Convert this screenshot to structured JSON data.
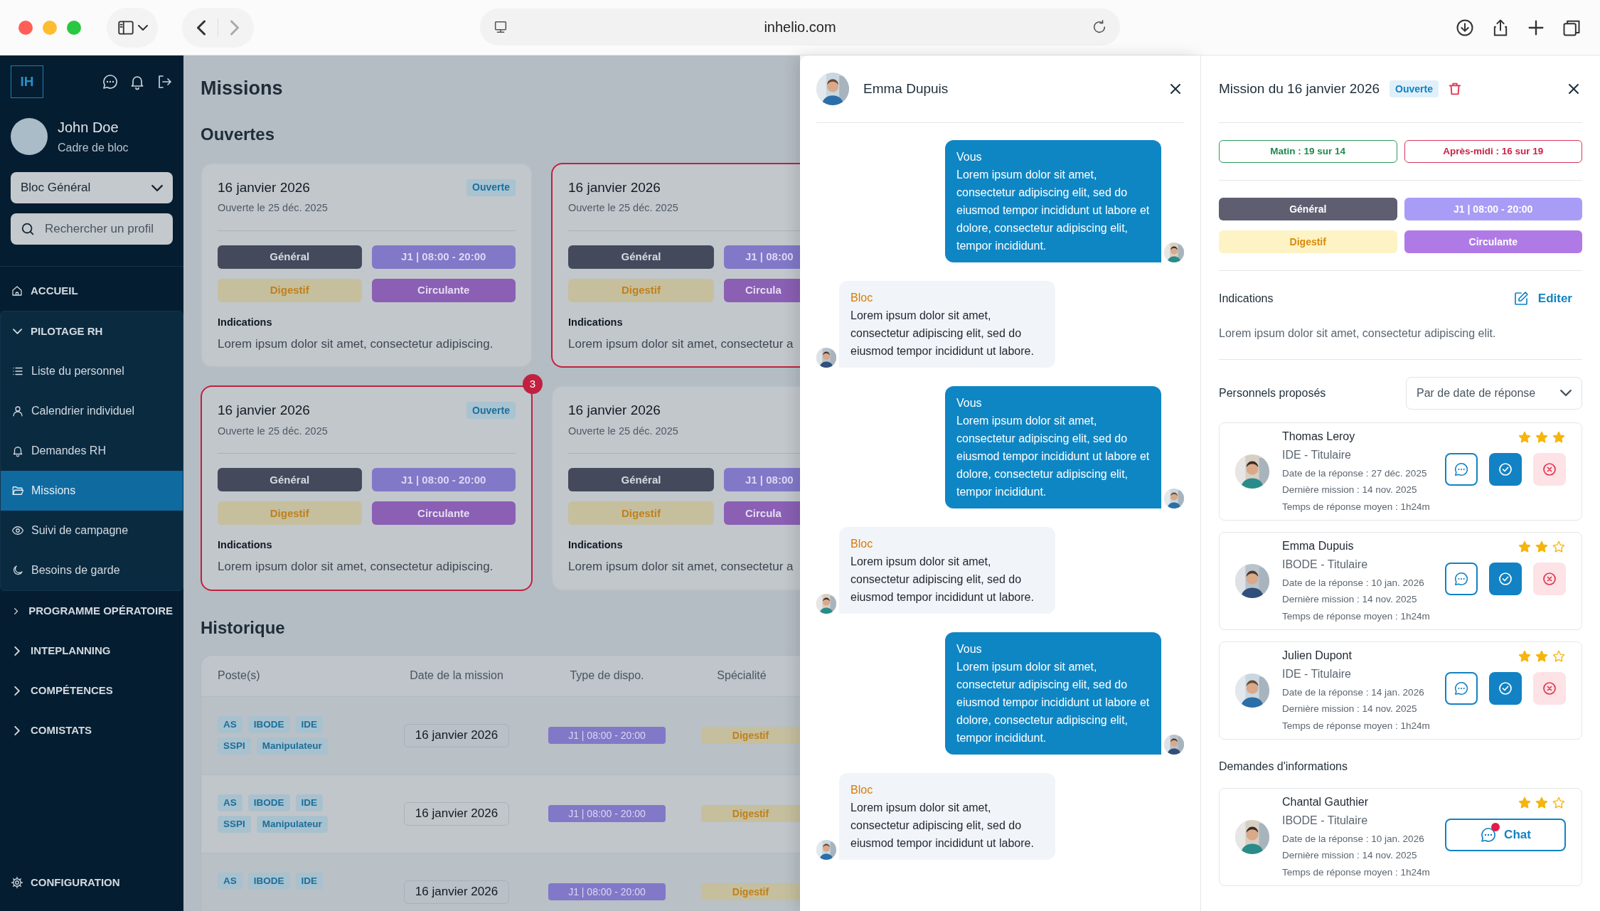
{
  "browser": {
    "url": "inhelio.com"
  },
  "sidebar": {
    "logo": "IH",
    "user": {
      "name": "John Doe",
      "role": "Cadre de bloc"
    },
    "site_select": "Bloc Général",
    "search": {
      "placeholder": "Rechercher un profil"
    },
    "nav": [
      {
        "label": "ACCUEIL",
        "kind": "link"
      },
      {
        "label": "PILOTAGE RH",
        "kind": "section",
        "expanded": true,
        "children": [
          {
            "label": "Liste du personnel",
            "selected": false
          },
          {
            "label": "Calendrier individuel",
            "selected": false
          },
          {
            "label": "Demandes RH",
            "selected": false
          },
          {
            "label": "Missions",
            "selected": true
          },
          {
            "label": "Suivi de campagne",
            "selected": false
          },
          {
            "label": "Besoins de garde",
            "selected": false
          }
        ]
      },
      {
        "label": "PROGRAMME OPÉRATOIRE",
        "kind": "section",
        "expanded": false
      },
      {
        "label": "INTEPLANNING",
        "kind": "section",
        "expanded": false
      },
      {
        "label": "COMPÉTENCES",
        "kind": "section",
        "expanded": false
      },
      {
        "label": "COMISTATS",
        "kind": "section",
        "expanded": false
      }
    ],
    "footer_link": "CONFIGURATION"
  },
  "main": {
    "title": "Missions",
    "open_missions": {
      "title": "Ouvertes",
      "cards": [
        {
          "date": "16 janvier 2026",
          "opened": "Ouverte le 25 déc. 2025",
          "status": "Ouverte",
          "alert": false,
          "clipped": false,
          "tags": [
            {
              "label": "Général",
              "kind": "service"
            },
            {
              "label": "J1 | 08:00 - 20:00",
              "kind": "shift"
            },
            {
              "label": "Digestif",
              "kind": "specialty"
            },
            {
              "label": "Circulante",
              "kind": "role"
            }
          ],
          "indications_label": "Indications",
          "indications": "Lorem ipsum dolor sit amet, consectetur adipiscing."
        },
        {
          "date": "16 janvier 2026",
          "opened": "Ouverte le 25 déc. 2025",
          "alert": true,
          "clipped": true,
          "tags": [
            {
              "label": "Général",
              "kind": "service"
            },
            {
              "label": "J1 | 08:00",
              "kind": "shift"
            },
            {
              "label": "Digestif",
              "kind": "specialty"
            },
            {
              "label": "Circula",
              "kind": "role"
            }
          ],
          "indications_label": "Indications",
          "indications": "Lorem ipsum dolor sit amet, consectetur a"
        },
        {
          "date": "16 janvier 2026",
          "opened": "Ouverte le 25 déc. 2025",
          "status": "Ouverte",
          "alert": true,
          "count": "3",
          "clipped": false,
          "tags": [
            {
              "label": "Général",
              "kind": "service"
            },
            {
              "label": "J1 | 08:00 - 20:00",
              "kind": "shift"
            },
            {
              "label": "Digestif",
              "kind": "specialty"
            },
            {
              "label": "Circulante",
              "kind": "role"
            }
          ],
          "indications_label": "Indications",
          "indications": "Lorem ipsum dolor sit amet, consectetur adipiscing."
        },
        {
          "date": "16 janvier 2026",
          "opened": "Ouverte le 25 déc. 2025",
          "alert": false,
          "clipped": true,
          "tags": [
            {
              "label": "Général",
              "kind": "service"
            },
            {
              "label": "J1 | 08:00",
              "kind": "shift"
            },
            {
              "label": "Digestif",
              "kind": "specialty"
            },
            {
              "label": "Circula",
              "kind": "role"
            }
          ],
          "indications_label": "Indications",
          "indications": "Lorem ipsum dolor sit amet, consectetur a"
        }
      ]
    },
    "history": {
      "title": "Historique",
      "columns": [
        "Poste(s)",
        "Date de la mission",
        "Type de dispo.",
        "Spécialité"
      ],
      "rows": [
        {
          "postes": [
            "AS",
            "IBODE",
            "IDE",
            "SSPI",
            "Manipulateur"
          ],
          "date": "16 janvier 2026",
          "dispo": "J1 | 08:00 - 20:00",
          "specialite": "Digestif"
        },
        {
          "postes": [
            "AS",
            "IBODE",
            "IDE",
            "SSPI",
            "Manipulateur"
          ],
          "date": "16 janvier 2026",
          "dispo": "J1 | 08:00 - 20:00",
          "specialite": "Digestif"
        },
        {
          "postes": [
            "AS",
            "IBODE",
            "IDE"
          ],
          "date": "16 janvier 2026",
          "dispo": "J1 | 08:00 - 20:00",
          "specialite": "Digestif"
        }
      ]
    }
  },
  "chat": {
    "contact": "Emma Dupuis",
    "messages": [
      {
        "author": "Vous",
        "kind": "sent",
        "text": "Lorem ipsum dolor sit amet, consectetur adipiscing elit, sed do eiusmod tempor incididunt ut labore et dolore, consectetur adipiscing elit, tempor incididunt."
      },
      {
        "author": "Bloc",
        "kind": "received",
        "text": "Lorem ipsum dolor sit amet, consectetur adipiscing elit, sed do eiusmod tempor incididunt ut labore."
      },
      {
        "author": "Vous",
        "kind": "sent",
        "text": "Lorem ipsum dolor sit amet, consectetur adipiscing elit, sed do eiusmod tempor incididunt ut labore et dolore, consectetur adipiscing elit, tempor incididunt."
      },
      {
        "author": "Bloc",
        "kind": "received",
        "text": "Lorem ipsum dolor sit amet, consectetur adipiscing elit, sed do eiusmod tempor incididunt ut labore."
      },
      {
        "author": "Vous",
        "kind": "sent",
        "text": "Lorem ipsum dolor sit amet, consectetur adipiscing elit, sed do eiusmod tempor incididunt ut labore et dolore, consectetur adipiscing elit, tempor incididunt."
      },
      {
        "author": "Bloc",
        "kind": "received",
        "text": "Lorem ipsum dolor sit amet, consectetur adipiscing elit, sed do eiusmod tempor incididunt ut labore."
      }
    ]
  },
  "detail": {
    "title": "Mission du 16 janvier 2026",
    "status": "Ouverte",
    "coverage": [
      {
        "label": "Matin : 19 sur 14",
        "kind": "ok"
      },
      {
        "label": "Après-midi : 16 sur 19",
        "kind": "short"
      }
    ],
    "tags": [
      {
        "label": "Général",
        "kind": "service"
      },
      {
        "label": "J1 | 08:00 - 20:00",
        "kind": "shift"
      },
      {
        "label": "Digestif",
        "kind": "specialty"
      },
      {
        "label": "Circulante",
        "kind": "role"
      }
    ],
    "indications": {
      "label": "Indications",
      "edit": "Editer",
      "text": "Lorem ipsum dolor sit amet, consectetur adipiscing elit."
    },
    "proposed": {
      "title": "Personnels proposés",
      "sort": "Par de date de réponse",
      "people": [
        {
          "name": "Thomas Leroy",
          "role": "IDE - Titulaire",
          "response": "Date de la réponse : 27 déc. 2025",
          "last": "Dernière mission : 14 nov. 2025",
          "avg": "Temps de réponse moyen : 1h24m",
          "stars": 3
        },
        {
          "name": "Emma Dupuis",
          "role": "IBODE - Titulaire",
          "response": "Date de la réponse : 10 jan. 2026",
          "last": "Dernière mission : 14 nov. 2025",
          "avg": "Temps de réponse moyen : 1h24m",
          "stars": 2
        },
        {
          "name": "Julien Dupont",
          "role": "IDE - Titulaire",
          "response": "Date de la réponse : 14 jan. 2026",
          "last": "Dernière mission : 14 nov. 2025",
          "avg": "Temps de réponse moyen : 1h24m",
          "stars": 2
        }
      ]
    },
    "requests": {
      "title": "Demandes d'informations",
      "people": [
        {
          "name": "Chantal Gauthier",
          "role": "IBODE - Titulaire",
          "response": "Date de la réponse : 10 jan. 2026",
          "last": "Dernière mission : 14 nov. 2025",
          "avg": "Temps de réponse moyen : 1h24m",
          "stars": 2,
          "action": "Chat",
          "unread": true
        }
      ]
    }
  }
}
